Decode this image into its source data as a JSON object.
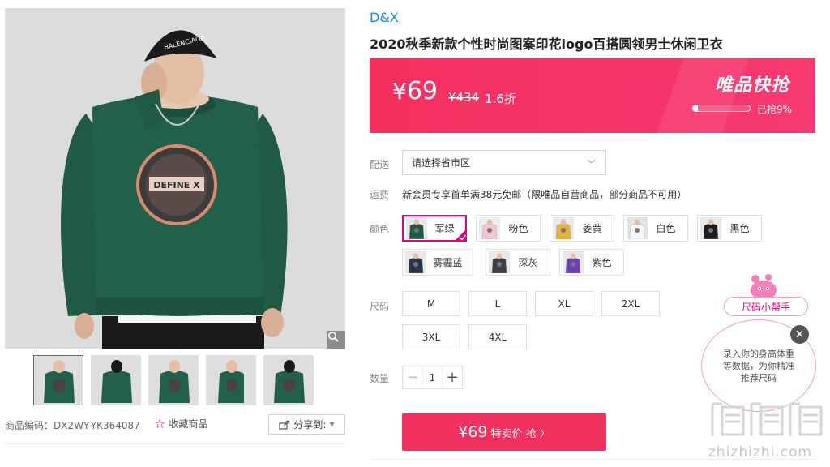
{
  "gallery": {
    "zoom_icon": "search-icon",
    "thumbnail_count": 5,
    "product_code_label": "商品编码：",
    "product_code": "DX2WY-YK364087",
    "favorite_label": "收藏商品",
    "share_label": "分享到:",
    "print_text": "DEFINE X",
    "cap_text": "BALENCIAGA"
  },
  "product": {
    "brand": "D&X",
    "title": "2020秋季新款个性时尚图案印花logo百搭圆领男士休闲卫衣"
  },
  "price": {
    "current": "69",
    "currency": "¥",
    "original": "¥434",
    "discount": "1.6折",
    "flash_title": "唯品快抢",
    "sold_progress": 0.09,
    "sold_text": "已抢9%"
  },
  "delivery": {
    "label": "配送",
    "placeholder": "请选择省市区"
  },
  "shipping": {
    "label": "运费",
    "text": "新会员专享首单满38元免邮（限唯品自营商品，部分商品不可用）"
  },
  "colors": {
    "label": "颜色",
    "options": [
      {
        "name": "军绿",
        "shirt": "#1f5a44",
        "bg": "#e9e9e9"
      },
      {
        "name": "粉色",
        "shirt": "#f2c6cc",
        "bg": "#eeeeee"
      },
      {
        "name": "姜黄",
        "shirt": "#e2b23a",
        "bg": "#e9e9e9"
      },
      {
        "name": "白色",
        "shirt": "#f7f7f7",
        "bg": "#e3e3e3"
      },
      {
        "name": "黑色",
        "shirt": "#1c1c1c",
        "bg": "#e9e9e9"
      },
      {
        "name": "雾霾蓝",
        "shirt": "#27344d",
        "bg": "#e9e9e9"
      },
      {
        "name": "深灰",
        "shirt": "#3d3e42",
        "bg": "#e9e9e9"
      },
      {
        "name": "紫色",
        "shirt": "#6d3fb6",
        "bg": "#e9e9e9"
      }
    ],
    "selected": "军绿"
  },
  "sizes": {
    "label": "尺码",
    "options": [
      "M",
      "L",
      "XL",
      "2XL",
      "3XL",
      "4XL"
    ]
  },
  "quantity": {
    "label": "数量",
    "value": "1",
    "minus": "−",
    "plus": "+"
  },
  "buy": {
    "price": "¥69",
    "label": "特卖价 抢 〉"
  },
  "size_helper": {
    "tab_label": "尺码小帮手",
    "bubble_text": "录入你的身高体重等数据，为你精准推荐尺码",
    "close": "✕"
  },
  "watermark": {
    "text": "zhizhizhi.com"
  },
  "colors_theme": {
    "accent": "#e4007f",
    "price_bar": "#f4305f",
    "buy_button": "#f0305e",
    "brand_link": "#1a8ad6",
    "shirt_green": "#1f5a44"
  }
}
